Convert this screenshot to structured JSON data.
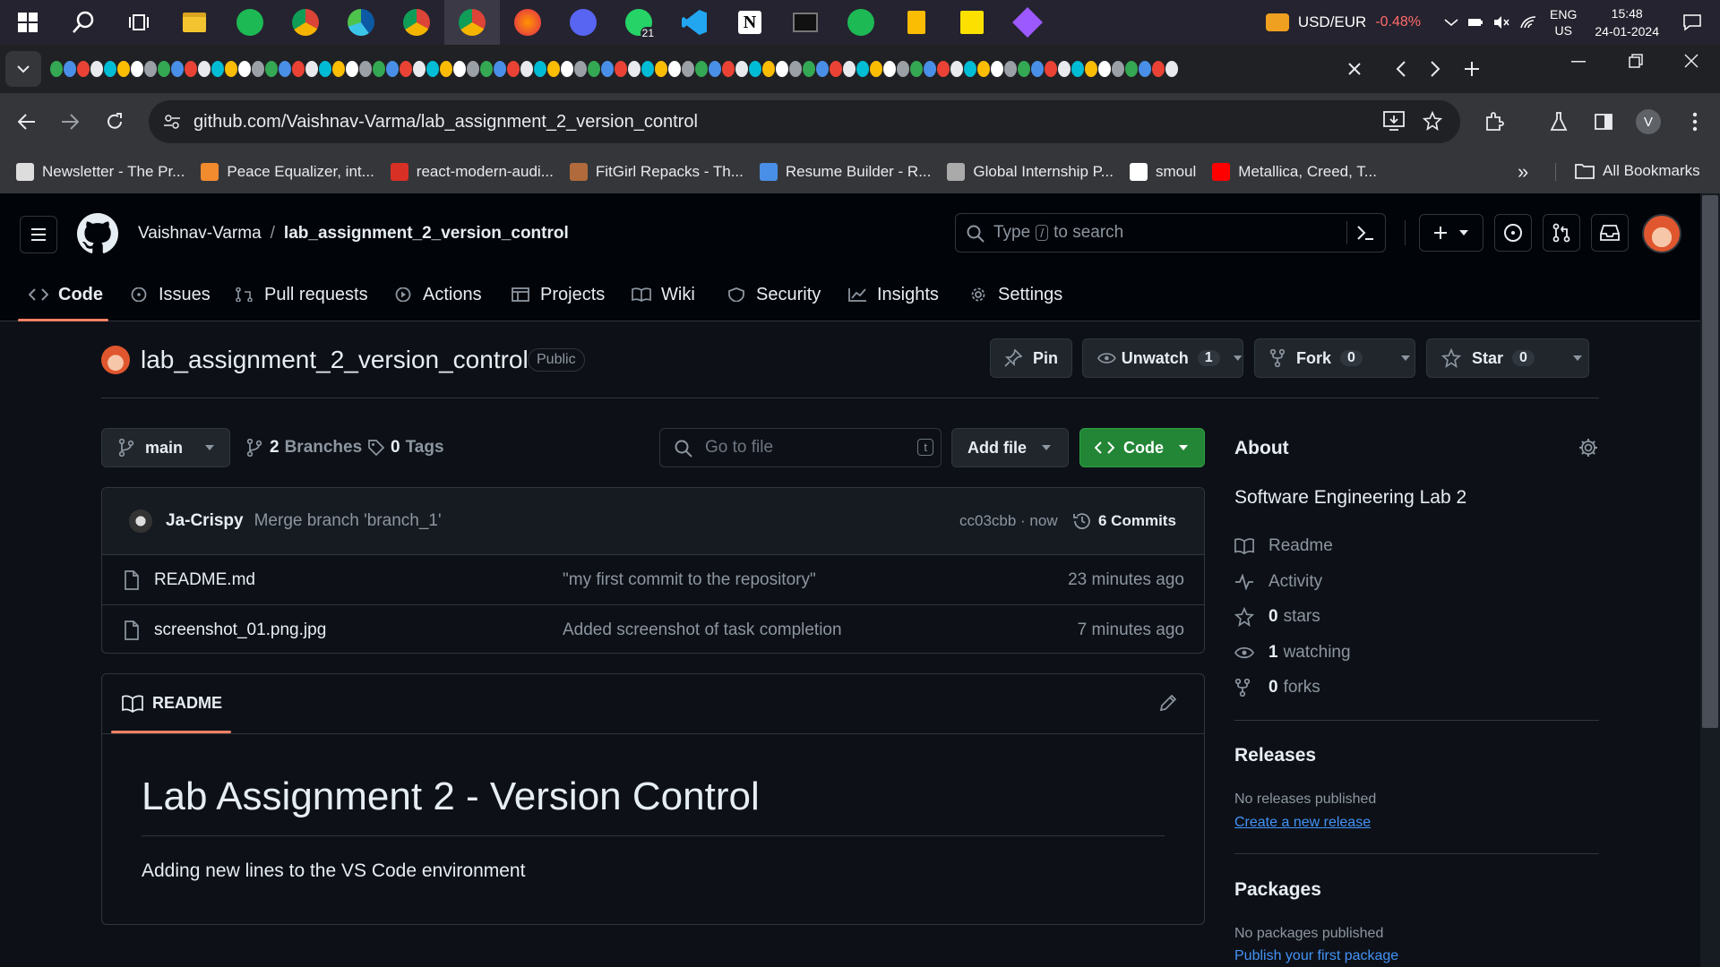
{
  "taskbar": {
    "currency": "USD/EUR",
    "currency_change": "-0.48%",
    "lang_top": "ENG",
    "lang_bottom": "US",
    "time": "15:48",
    "date": "24-01-2024",
    "whatsapp_badge": "21",
    "apps": [
      "windows-start",
      "search",
      "task-view",
      "file-explorer",
      "spotify",
      "chrome-beta",
      "edge",
      "chrome-canary",
      "chrome-profile",
      "firefox",
      "discord",
      "whatsapp",
      "vscode",
      "notion",
      "terminal",
      "spotify-2",
      "keep",
      "sticky-notes",
      "git-tool"
    ]
  },
  "browser": {
    "url": "github.com/Vaishnav-Varma/lab_assignment_2_version_control",
    "bookmarks": [
      {
        "label": "Newsletter - The Pr...",
        "color": "#ddd"
      },
      {
        "label": "Peace Equalizer, int...",
        "color": "#f28b2e"
      },
      {
        "label": "react-modern-audi...",
        "color": "#d93025"
      },
      {
        "label": "FitGirl Repacks - Th...",
        "color": "#b06a3b"
      },
      {
        "label": "Resume Builder - R...",
        "color": "#4a8fe7"
      },
      {
        "label": "Global Internship P...",
        "color": "#aaaaaa"
      },
      {
        "label": "smoul",
        "color": "#ffffff"
      },
      {
        "label": "Metallica, Creed, T...",
        "color": "#ff0000"
      }
    ],
    "more_bookmarks": "»",
    "all_bookmarks": "All Bookmarks",
    "profile_initial": "V"
  },
  "github": {
    "owner": "Vaishnav-Varma",
    "slash": "/",
    "repo": "lab_assignment_2_version_control",
    "search_type": "Type",
    "search_key": "/",
    "search_rest": "to search",
    "tabs": [
      {
        "label": "Code"
      },
      {
        "label": "Issues"
      },
      {
        "label": "Pull requests"
      },
      {
        "label": "Actions"
      },
      {
        "label": "Projects"
      },
      {
        "label": "Wiki"
      },
      {
        "label": "Security"
      },
      {
        "label": "Insights"
      },
      {
        "label": "Settings"
      }
    ],
    "visibility": "Public",
    "pin": "Pin",
    "unwatch": "Unwatch",
    "unwatch_count": "1",
    "fork": "Fork",
    "fork_count": "0",
    "star": "Star",
    "star_count": "0",
    "branch": "main",
    "branches_count": "2",
    "branches_label": "Branches",
    "tags_count": "0",
    "tags_label": "Tags",
    "goto_placeholder": "Go to file",
    "goto_key": "t",
    "add_file": "Add file",
    "code_btn": "Code",
    "commit": {
      "author": "Ja-Crispy",
      "message": "Merge branch 'branch_1'",
      "hash_time": "cc03cbb · now",
      "count": "6 Commits"
    },
    "files": [
      {
        "name": "README.md",
        "message": "\"my first commit to the repository\"",
        "time": "23 minutes ago"
      },
      {
        "name": "screenshot_01.png.jpg",
        "message": "Added screenshot of task completion",
        "time": "7 minutes ago"
      }
    ],
    "readme_tab": "README",
    "readme_title": "Lab Assignment 2 - Version Control",
    "readme_body": "Adding new lines to the VS Code environment",
    "about": {
      "heading": "About",
      "description": "Software Engineering Lab 2",
      "readme": "Readme",
      "activity": "Activity",
      "stars_count": "0",
      "stars": "stars",
      "watching_count": "1",
      "watching": "watching",
      "forks_count": "0",
      "forks": "forks"
    },
    "releases": {
      "heading": "Releases",
      "none": "No releases published",
      "create": "Create a new release"
    },
    "packages": {
      "heading": "Packages",
      "none": "No packages published",
      "publish": "Publish your first package"
    }
  }
}
